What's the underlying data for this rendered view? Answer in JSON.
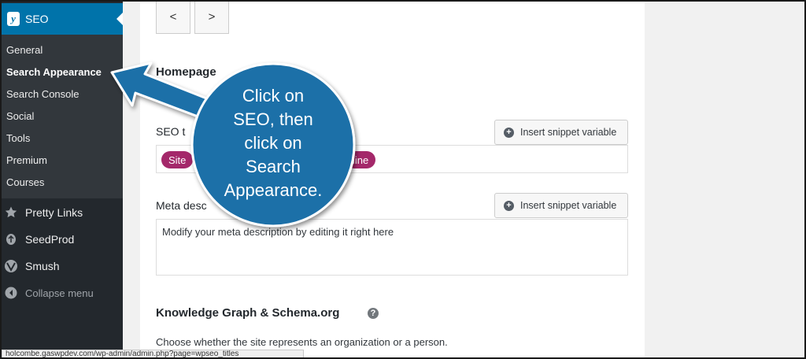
{
  "sidebar": {
    "seo_label": "SEO",
    "submenu": [
      "General",
      "Search Appearance",
      "Search Console",
      "Social",
      "Tools",
      "Premium",
      "Courses"
    ],
    "active_item": "Search Appearance",
    "main_items": [
      "Pretty Links",
      "SeedProd",
      "Smush"
    ],
    "collapse_label": "Collapse menu"
  },
  "nav": {
    "prev_label": "<",
    "next_label": ">"
  },
  "homepage": {
    "heading": "Homepage",
    "seo_title_label": "SEO t",
    "meta_label": "Meta desc",
    "snippet_button": "Insert snippet variable",
    "title_pills": [
      "Site",
      "line"
    ],
    "description_placeholder": "Modify your meta description by editing it right here"
  },
  "knowledge_graph": {
    "heading": "Knowledge Graph & Schema.org",
    "help_icon": "?",
    "description": "Choose whether the site represents an organization or a person."
  },
  "status_url": "holcombe.gaswpdev.com/wp-admin/admin.php?page=wpseo_titles",
  "callout": {
    "lines": [
      "Click on",
      "SEO, then",
      "click on",
      "Search",
      "Appearance."
    ],
    "color": "#1a6fa8"
  },
  "colors": {
    "sidebar": "#23282d",
    "submenu": "#32373c",
    "accent": "#0073aa",
    "pill": "#a4286a"
  }
}
